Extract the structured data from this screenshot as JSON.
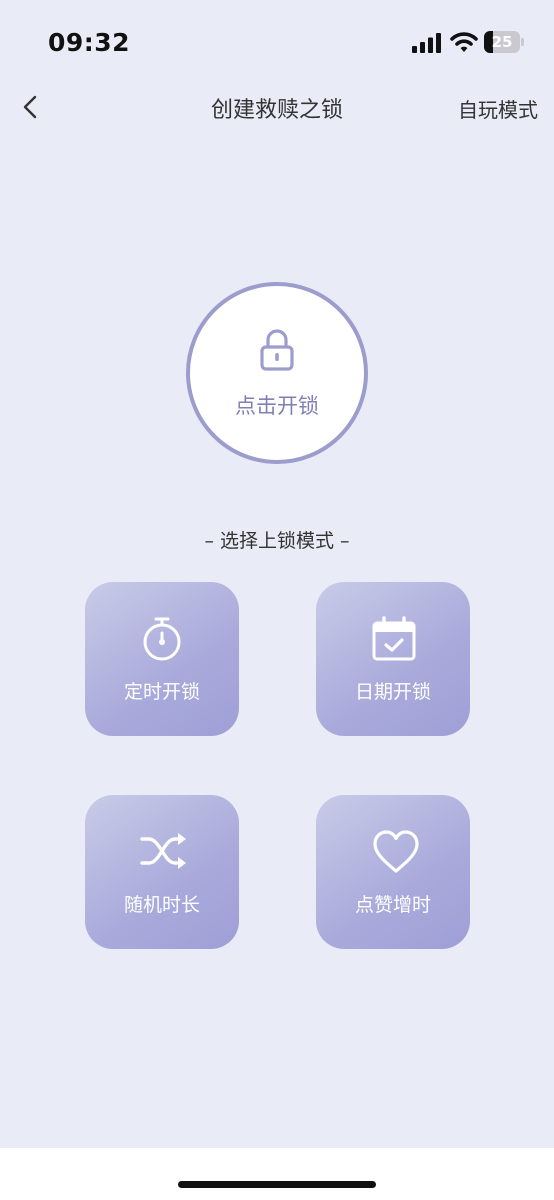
{
  "status_bar": {
    "time": "09:32",
    "battery_level": "25",
    "battery_fraction": 0.25,
    "icons": [
      "cellular-signal-icon",
      "wifi-icon",
      "battery-icon"
    ]
  },
  "nav": {
    "back_icon": "chevron-left-icon",
    "title": "创建救赎之锁",
    "right_label": "自玩模式"
  },
  "lock": {
    "icon": "lock-icon",
    "label": "点击开锁"
  },
  "section": {
    "title": "– 选择上锁模式 –"
  },
  "modes": [
    {
      "label": "定时开锁",
      "icon": "stopwatch-icon"
    },
    {
      "label": "日期开锁",
      "icon": "calendar-check-icon"
    },
    {
      "label": "随机时长",
      "icon": "shuffle-icon"
    },
    {
      "label": "点赞增时",
      "icon": "heart-icon"
    }
  ],
  "colors": {
    "background": "#e9ecf6",
    "accent": "#9c9dcd",
    "accent_text": "#7f80b5",
    "tile_gradient_start": "#c9cbe8",
    "tile_gradient_end": "#9e9fd6"
  }
}
